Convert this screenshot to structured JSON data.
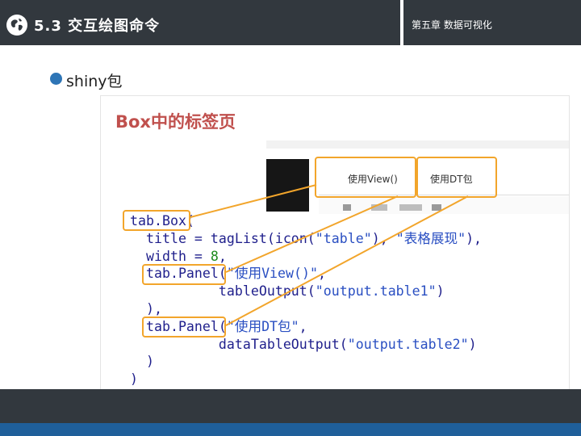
{
  "header": {
    "logo_icon": "globe-icon",
    "title": "5.3 交互绘图命令",
    "chapter": "第五章 数据可视化"
  },
  "bullet": {
    "text": "shiny包"
  },
  "screenshot": {
    "title": "Box中的标签页",
    "tabs": [
      "使用View()",
      "使用DT包"
    ],
    "code": {
      "line1": "tab.Box(",
      "line2_a": "  title = tagList(icon(",
      "line2_s1": "\"table\"",
      "line2_b": "), ",
      "line2_s2": "\"表格展现\"",
      "line2_c": "),",
      "line3_a": "  width = ",
      "line3_n": "8",
      "line3_b": ",",
      "line4_a": "  tab.Panel(",
      "line4_s": "\"使用View()\"",
      "line4_b": ",",
      "line5_a": "           tableOutput(",
      "line5_s": "\"output.table1\"",
      "line5_b": ")",
      "line6": "  ),",
      "line7_a": "  tab.Panel(",
      "line7_s": "\"使用DT包\"",
      "line7_b": ",",
      "line8_a": "           dataTableOutput(",
      "line8_s": "\"output.table2\"",
      "line8_b": ")",
      "line9": "  )",
      "line10": ")"
    },
    "highlight_color": "#f2a52b",
    "title_color": "#c0504d"
  },
  "colors": {
    "header_bg": "#32383e",
    "bullet": "#2e75b6",
    "footer_strip": "#1f5f9a"
  }
}
